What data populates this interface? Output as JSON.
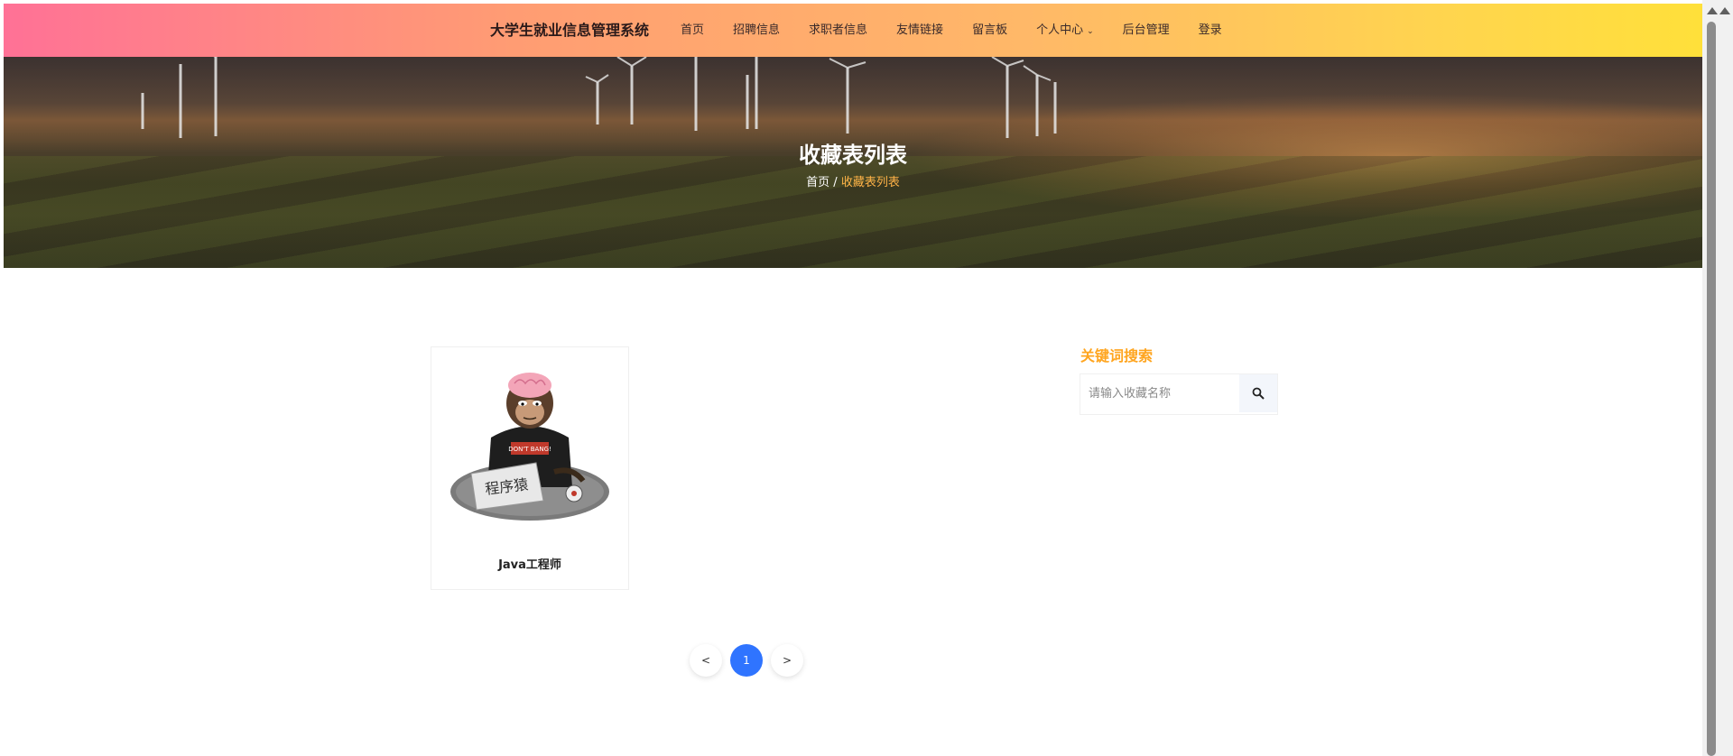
{
  "navbar": {
    "brand": "大学生就业信息管理系统",
    "links": [
      "首页",
      "招聘信息",
      "求职者信息",
      "友情链接",
      "留言板",
      "个人中心",
      "后台管理",
      "登录"
    ],
    "gradient_start": "#ff7196",
    "gradient_end": "#ffe03a"
  },
  "hero": {
    "title": "收藏表列表",
    "breadcrumb_home": "首页",
    "breadcrumb_sep": " / ",
    "breadcrumb_current": "收藏表列表"
  },
  "items": [
    {
      "title": "Java工程师",
      "image_icon": "programmer-monkey-image"
    }
  ],
  "sidebar": {
    "title": "关键词搜索",
    "search_placeholder": "请输入收藏名称",
    "search_value": ""
  },
  "pagination": {
    "prev": "<",
    "pages": [
      "1"
    ],
    "current": "1",
    "next": ">"
  },
  "colors": {
    "accent_orange": "#ffa51f",
    "page_active": "#2f74ff"
  }
}
